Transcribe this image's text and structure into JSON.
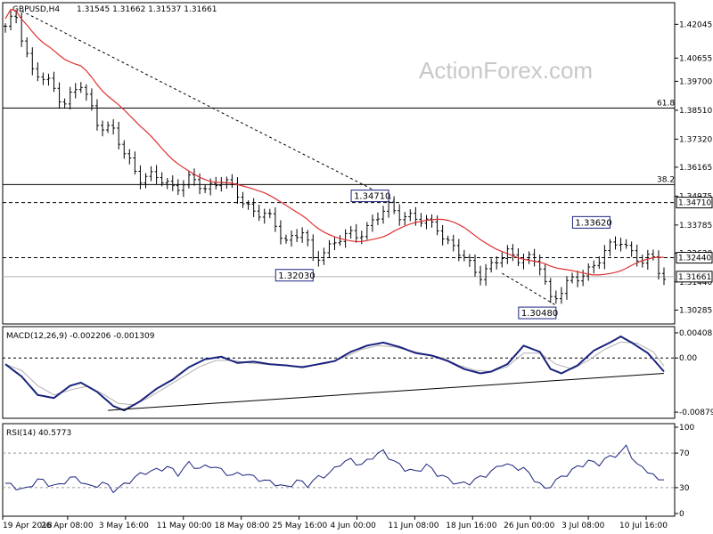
{
  "chart_data": [
    {
      "type": "candlestick",
      "symbol": "GBPUSD,H4",
      "ohlc_text": "1.31545 1.31662 1.31537 1.31661",
      "watermark": "ActionForex.com",
      "y_ticks": [
        "1.42045",
        "1.40655",
        "1.39700",
        "1.38510",
        "1.37320",
        "1.36165",
        "1.34975",
        "1.33785",
        "1.32630",
        "1.31440",
        "1.30285"
      ],
      "ylim": [
        1.2975,
        1.429
      ],
      "x_ticks": [
        "19 Apr 2018",
        "26 Apr 08:00",
        "3 May 16:00",
        "11 May 00:00",
        "18 May 08:00",
        "25 May 16:00",
        "4 Jun 00:00",
        "11 Jun 08:00",
        "18 Jun 16:00",
        "26 Jun 00:00",
        "3 Jul 08:00",
        "10 Jul 16:00"
      ],
      "fib_levels": [
        {
          "label": "61.8",
          "value": 1.386
        },
        {
          "label": "38.2",
          "value": 1.3545
        }
      ],
      "dashed_levels": [
        {
          "label": "1.34710",
          "value": 1.3471
        },
        {
          "label": "1.32440",
          "value": 1.3244
        }
      ],
      "current_price": {
        "label": "1.31661",
        "value": 1.31661
      },
      "annotations": [
        {
          "label": "1.34710",
          "bar": 71,
          "value": 1.3471
        },
        {
          "label": "1.33620",
          "bar": 112,
          "value": 1.3362
        },
        {
          "label": "1.32030",
          "bar": 57,
          "value": 1.3203
        },
        {
          "label": "1.30480",
          "bar": 102,
          "value": 1.3048
        }
      ],
      "trendline": {
        "from": {
          "bar": 3,
          "value": 1.426
        },
        "to": {
          "bar": 72,
          "value": 1.348
        }
      },
      "trendline2": {
        "from": {
          "bar": 92,
          "value": 1.318
        },
        "to": {
          "bar": 102,
          "value": 1.3048
        }
      },
      "bar_count": 123,
      "close_anchors": [
        [
          0,
          1.4185
        ],
        [
          2,
          1.424
        ],
        [
          5,
          1.401
        ],
        [
          8,
          1.396
        ],
        [
          11,
          1.389
        ],
        [
          14,
          1.395
        ],
        [
          17,
          1.381
        ],
        [
          20,
          1.376
        ],
        [
          22,
          1.367
        ],
        [
          25,
          1.358
        ],
        [
          28,
          1.357
        ],
        [
          31,
          1.354
        ],
        [
          34,
          1.356
        ],
        [
          37,
          1.353
        ],
        [
          40,
          1.357
        ],
        [
          43,
          1.35
        ],
        [
          46,
          1.344
        ],
        [
          48,
          1.342
        ],
        [
          50,
          1.337
        ],
        [
          52,
          1.332
        ],
        [
          55,
          1.335
        ],
        [
          57,
          1.323
        ],
        [
          59,
          1.328
        ],
        [
          62,
          1.332
        ],
        [
          65,
          1.334
        ],
        [
          68,
          1.339
        ],
        [
          71,
          1.345
        ],
        [
          74,
          1.342
        ],
        [
          77,
          1.339
        ],
        [
          80,
          1.338
        ],
        [
          82,
          1.33
        ],
        [
          85,
          1.324
        ],
        [
          88,
          1.318
        ],
        [
          90,
          1.32
        ],
        [
          93,
          1.327
        ],
        [
          96,
          1.324
        ],
        [
          99,
          1.321
        ],
        [
          101,
          1.308
        ],
        [
          103,
          1.311
        ],
        [
          106,
          1.316
        ],
        [
          109,
          1.322
        ],
        [
          112,
          1.328
        ],
        [
          114,
          1.332
        ],
        [
          116,
          1.327
        ],
        [
          118,
          1.322
        ],
        [
          120,
          1.324
        ],
        [
          122,
          1.3166
        ]
      ]
    },
    {
      "type": "line",
      "title": "MACD(12,26,9) -0.002206 -0.001309",
      "y_ticks": [
        "0.004081",
        "0.00",
        "-0.008794"
      ],
      "ylim": [
        -0.0095,
        0.0048
      ],
      "series": [
        {
          "values": [
            [
              0,
              -0.001
            ],
            [
              3,
              -0.003
            ],
            [
              6,
              -0.006
            ],
            [
              9,
              -0.0065
            ],
            [
              12,
              -0.0045
            ],
            [
              14,
              -0.004
            ],
            [
              17,
              -0.0055
            ],
            [
              20,
              -0.0078
            ],
            [
              22,
              -0.0085
            ],
            [
              25,
              -0.007
            ],
            [
              28,
              -0.005
            ],
            [
              31,
              -0.0035
            ],
            [
              34,
              -0.0015
            ],
            [
              37,
              -0.0002
            ],
            [
              40,
              0.0002
            ],
            [
              43,
              -0.0008
            ],
            [
              46,
              -0.0006
            ],
            [
              49,
              -0.001
            ],
            [
              52,
              -0.0012
            ],
            [
              55,
              -0.0015
            ],
            [
              58,
              -0.001
            ],
            [
              61,
              -0.0005
            ],
            [
              64,
              0.001
            ],
            [
              67,
              0.002
            ],
            [
              70,
              0.0025
            ],
            [
              73,
              0.0018
            ],
            [
              76,
              0.0008
            ],
            [
              79,
              0.0004
            ],
            [
              82,
              -0.0005
            ],
            [
              85,
              -0.0018
            ],
            [
              88,
              -0.0025
            ],
            [
              90,
              -0.0022
            ],
            [
              93,
              -0.001
            ],
            [
              96,
              0.002
            ],
            [
              99,
              0.001
            ],
            [
              101,
              -0.0018
            ],
            [
              103,
              -0.0025
            ],
            [
              106,
              -0.0012
            ],
            [
              109,
              0.0012
            ],
            [
              112,
              0.0025
            ],
            [
              114,
              0.0035
            ],
            [
              116,
              0.0025
            ],
            [
              119,
              0.0008
            ],
            [
              122,
              -0.0022
            ]
          ]
        },
        {
          "values": [
            [
              0,
              -0.001
            ],
            [
              3,
              -0.002
            ],
            [
              6,
              -0.0045
            ],
            [
              9,
              -0.006
            ],
            [
              12,
              -0.0052
            ],
            [
              15,
              -0.0046
            ],
            [
              18,
              -0.0058
            ],
            [
              21,
              -0.0074
            ],
            [
              24,
              -0.0076
            ],
            [
              27,
              -0.0062
            ],
            [
              30,
              -0.0046
            ],
            [
              33,
              -0.003
            ],
            [
              36,
              -0.0014
            ],
            [
              39,
              -0.0004
            ],
            [
              42,
              -0.0004
            ],
            [
              45,
              -0.0008
            ],
            [
              48,
              -0.001
            ],
            [
              51,
              -0.0012
            ],
            [
              54,
              -0.0014
            ],
            [
              57,
              -0.0012
            ],
            [
              60,
              -0.0008
            ],
            [
              63,
              0.0002
            ],
            [
              66,
              0.0014
            ],
            [
              69,
              0.002
            ],
            [
              72,
              0.0018
            ],
            [
              75,
              0.0012
            ],
            [
              78,
              0.0006
            ],
            [
              81,
              0.0
            ],
            [
              84,
              -0.0012
            ],
            [
              87,
              -0.002
            ],
            [
              90,
              -0.0022
            ],
            [
              93,
              -0.0014
            ],
            [
              96,
              0.0008
            ],
            [
              99,
              0.0008
            ],
            [
              102,
              -0.001
            ],
            [
              105,
              -0.0018
            ],
            [
              108,
              -0.0004
            ],
            [
              111,
              0.0014
            ],
            [
              114,
              0.0026
            ],
            [
              117,
              0.0024
            ],
            [
              120,
              0.001
            ],
            [
              122,
              -0.0013
            ]
          ]
        }
      ],
      "support_line": {
        "from": {
          "bar": 19,
          "value": -0.0085
        },
        "to": {
          "bar": 122,
          "value": -0.0025
        }
      }
    },
    {
      "type": "line",
      "title": "RSI(14) 40.5773",
      "y_ticks": [
        "100",
        "70",
        "30",
        "0"
      ],
      "ylim": [
        0,
        100
      ],
      "levels": [
        70,
        30
      ],
      "series": [
        {
          "values": [
            [
              0,
              35
            ],
            [
              2,
              30
            ],
            [
              4,
              28
            ],
            [
              6,
              40
            ],
            [
              8,
              34
            ],
            [
              10,
              32
            ],
            [
              12,
              42
            ],
            [
              14,
              38
            ],
            [
              16,
              30
            ],
            [
              18,
              36
            ],
            [
              20,
              27
            ],
            [
              22,
              33
            ],
            [
              24,
              42
            ],
            [
              26,
              48
            ],
            [
              28,
              50
            ],
            [
              30,
              54
            ],
            [
              32,
              46
            ],
            [
              34,
              58
            ],
            [
              36,
              52
            ],
            [
              38,
              56
            ],
            [
              40,
              50
            ],
            [
              42,
              44
            ],
            [
              44,
              47
            ],
            [
              46,
              42
            ],
            [
              48,
              38
            ],
            [
              50,
              35
            ],
            [
              52,
              30
            ],
            [
              54,
              38
            ],
            [
              56,
              33
            ],
            [
              58,
              42
            ],
            [
              60,
              46
            ],
            [
              62,
              58
            ],
            [
              64,
              62
            ],
            [
              66,
              56
            ],
            [
              68,
              66
            ],
            [
              70,
              72
            ],
            [
              72,
              60
            ],
            [
              74,
              52
            ],
            [
              76,
              48
            ],
            [
              78,
              56
            ],
            [
              80,
              46
            ],
            [
              82,
              40
            ],
            [
              84,
              34
            ],
            [
              86,
              36
            ],
            [
              88,
              42
            ],
            [
              90,
              48
            ],
            [
              92,
              58
            ],
            [
              94,
              54
            ],
            [
              96,
              52
            ],
            [
              98,
              40
            ],
            [
              100,
              28
            ],
            [
              102,
              38
            ],
            [
              104,
              46
            ],
            [
              106,
              54
            ],
            [
              108,
              60
            ],
            [
              110,
              58
            ],
            [
              112,
              66
            ],
            [
              114,
              70
            ],
            [
              115,
              78
            ],
            [
              117,
              56
            ],
            [
              119,
              50
            ],
            [
              121,
              38
            ],
            [
              122,
              42
            ]
          ]
        }
      ]
    }
  ]
}
